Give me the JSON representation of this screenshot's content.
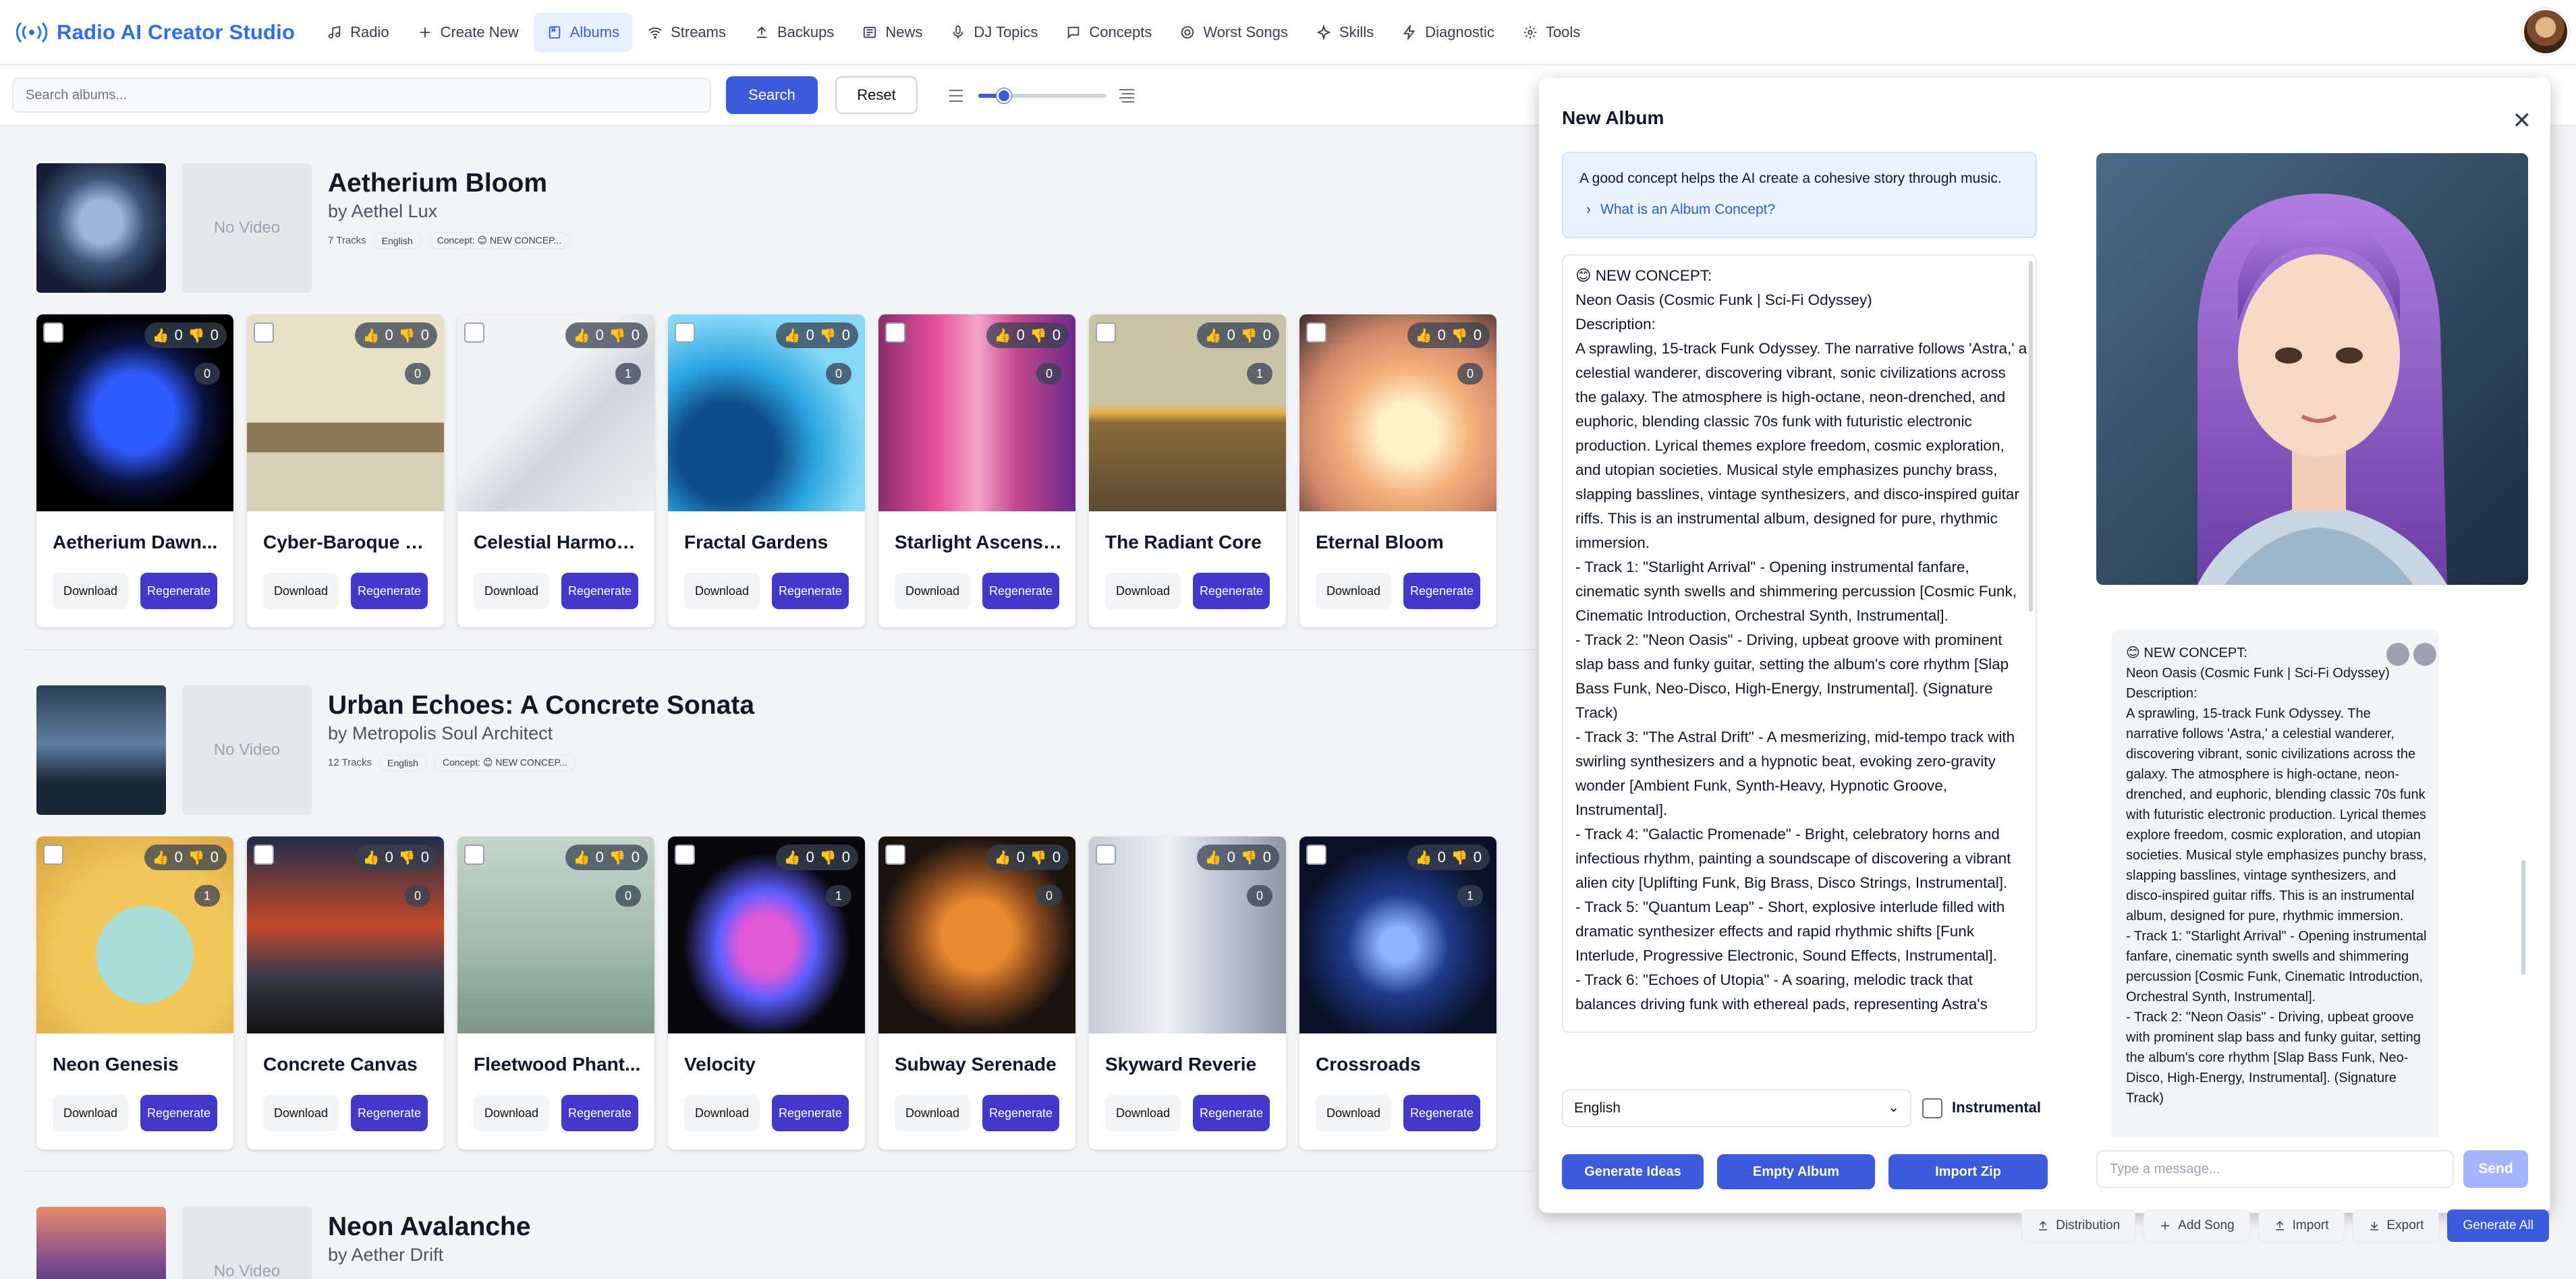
{
  "app": {
    "title": "Radio AI Creator Studio"
  },
  "nav": [
    {
      "label": "Radio",
      "icon": "music-note-icon"
    },
    {
      "label": "Create New",
      "icon": "plus-icon"
    },
    {
      "label": "Albums",
      "icon": "album-icon",
      "active": true
    },
    {
      "label": "Streams",
      "icon": "wifi-icon"
    },
    {
      "label": "Backups",
      "icon": "upload-icon"
    },
    {
      "label": "News",
      "icon": "newspaper-icon"
    },
    {
      "label": "DJ Topics",
      "icon": "microphone-icon"
    },
    {
      "label": "Concepts",
      "icon": "chat-icon"
    },
    {
      "label": "Worst Songs",
      "icon": "target-icon"
    },
    {
      "label": "Skills",
      "icon": "sparkle-icon"
    },
    {
      "label": "Diagnostic",
      "icon": "bolt-icon"
    },
    {
      "label": "Tools",
      "icon": "gear-icon"
    }
  ],
  "toolbar": {
    "search_placeholder": "Search albums...",
    "search_label": "Search",
    "reset_label": "Reset",
    "zoom_level": 0.2
  },
  "albums": [
    {
      "title": "Aetherium Bloom",
      "artist": "by Aethel Lux",
      "tracks_count": "7 Tracks",
      "language": "English",
      "concept_pill": "Concept: 😊 NEW CONCEP...",
      "video_label": "No Video",
      "tracks": [
        {
          "title": "Aetherium Dawn...",
          "up": "0",
          "down": "0",
          "count": "0"
        },
        {
          "title": "Cyber-Baroque C...",
          "up": "0",
          "down": "0",
          "count": "0"
        },
        {
          "title": "Celestial Harmonia",
          "up": "0",
          "down": "0",
          "count": "1"
        },
        {
          "title": "Fractal Gardens",
          "up": "0",
          "down": "0",
          "count": "0"
        },
        {
          "title": "Starlight Ascension",
          "up": "0",
          "down": "0",
          "count": "0"
        },
        {
          "title": "The Radiant Core",
          "up": "0",
          "down": "0",
          "count": "1"
        },
        {
          "title": "Eternal Bloom",
          "up": "0",
          "down": "0",
          "count": "0"
        }
      ]
    },
    {
      "title": "Urban Echoes: A Concrete Sonata",
      "artist": "by Metropolis Soul Architect",
      "tracks_count": "12 Tracks",
      "language": "English",
      "concept_pill": "Concept: 😊 NEW CONCEP...",
      "video_label": "No Video",
      "tracks": [
        {
          "title": "Neon Genesis",
          "up": "0",
          "down": "0",
          "count": "1"
        },
        {
          "title": "Concrete Canvas",
          "up": "0",
          "down": "0",
          "count": "0"
        },
        {
          "title": "Fleetwood Phant...",
          "up": "0",
          "down": "0",
          "count": "0"
        },
        {
          "title": "Velocity",
          "up": "0",
          "down": "0",
          "count": "1"
        },
        {
          "title": "Subway Serenade",
          "up": "0",
          "down": "0",
          "count": "0"
        },
        {
          "title": "Skyward Reverie",
          "up": "0",
          "down": "0",
          "count": "0"
        },
        {
          "title": "Crossroads",
          "up": "0",
          "down": "0",
          "count": "1"
        }
      ]
    },
    {
      "title": "Neon Avalanche",
      "artist": "by Aether Drift",
      "video_label": "No Video"
    }
  ],
  "track_buttons": {
    "download": "Download",
    "regenerate": "Regenerate"
  },
  "modal": {
    "title": "New Album",
    "info_text": "A good concept helps the AI create a cohesive story through music.",
    "info_link": "What is an Album Concept?",
    "concept_text": "😊 NEW CONCEPT:\nNeon Oasis (Cosmic Funk | Sci-Fi Odyssey)\nDescription:\nA sprawling, 15-track Funk Odyssey. The narrative follows 'Astra,' a celestial wanderer, discovering vibrant, sonic civilizations across the galaxy. The atmosphere is high-octane, neon-drenched, and euphoric, blending classic 70s funk with futuristic electronic production. Lyrical themes explore freedom, cosmic exploration, and utopian societies. Musical style emphasizes punchy brass, slapping basslines, vintage synthesizers, and disco-inspired guitar riffs. This is an instrumental album, designed for pure, rhythmic immersion.\n- Track 1: \"Starlight Arrival\" - Opening instrumental fanfare, cinematic synth swells and shimmering percussion [Cosmic Funk, Cinematic Introduction, Orchestral Synth, Instrumental].\n- Track 2: \"Neon Oasis\" - Driving, upbeat groove with prominent slap bass and funky guitar, setting the album's core rhythm [Slap Bass Funk, Neo-Disco, High-Energy, Instrumental]. (Signature Track)\n- Track 3: \"The Astral Drift\" - A mesmerizing, mid-tempo track with swirling synthesizers and a hypnotic beat, evoking zero-gravity wonder [Ambient Funk, Synth-Heavy, Hypnotic Groove, Instrumental].\n- Track 4: \"Galactic Promenade\" - Bright, celebratory horns and infectious rhythm, painting a soundscape of discovering a vibrant alien city [Uplifting Funk, Big Brass, Disco Strings, Instrumental].\n- Track 5: \"Quantum Leap\" - Short, explosive interlude filled with dramatic synthesizer effects and rapid rhythmic shifts [Funk Interlude, Progressive Electronic, Sound Effects, Instrumental].\n- Track 6: \"Echoes of Utopia\" - A soaring, melodic track that balances driving funk with ethereal pads, representing Astra's",
    "language": "English",
    "instrumental_label": "Instrumental",
    "btn_generate": "Generate Ideas",
    "btn_empty": "Empty Album",
    "btn_import": "Import Zip",
    "chat_text": "😊 NEW CONCEPT:\nNeon Oasis (Cosmic Funk | Sci-Fi Odyssey)\nDescription:\nA sprawling, 15-track Funk Odyssey. The narrative follows 'Astra,' a celestial wanderer, discovering vibrant, sonic civilizations across the galaxy. The atmosphere is high-octane, neon-drenched, and euphoric, blending classic 70s funk with futuristic electronic production. Lyrical themes explore freedom, cosmic exploration, and utopian societies. Musical style emphasizes punchy brass, slapping basslines, vintage synthesizers, and disco-inspired guitar riffs. This is an instrumental album, designed for pure, rhythmic immersion.\n- Track 1: \"Starlight Arrival\" - Opening instrumental fanfare, cinematic synth swells and shimmering percussion [Cosmic Funk, Cinematic Introduction, Orchestral Synth, Instrumental].\n- Track 2: \"Neon Oasis\" - Driving, upbeat groove with prominent slap bass and funky guitar, setting the album's core rhythm [Slap Bass Funk, Neo-Disco, High-Energy, Instrumental]. (Signature Track)",
    "chat_placeholder": "Type a message...",
    "send_label": "Send"
  },
  "bottombar": [
    {
      "label": "Distribution",
      "icon": "upload-icon"
    },
    {
      "label": "Add Song",
      "icon": "plus-icon"
    },
    {
      "label": "Import",
      "icon": "upload-icon"
    },
    {
      "label": "Export",
      "icon": "download-icon"
    },
    {
      "label": "Generate All",
      "primary": true
    }
  ],
  "colors": {
    "accent": "#3b5bdb",
    "regenerate": "#4338ca",
    "brand": "#2f6fed"
  }
}
